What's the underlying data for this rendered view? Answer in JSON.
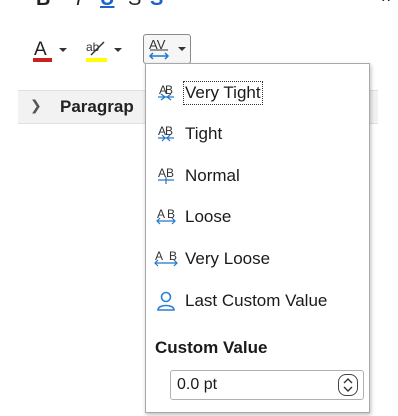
{
  "popup": {
    "items": [
      {
        "label": "Very Tight",
        "icon": "very-tight-spacing-icon"
      },
      {
        "label": "Tight",
        "icon": "tight-spacing-icon"
      },
      {
        "label": "Normal",
        "icon": "normal-spacing-icon"
      },
      {
        "label": "Loose",
        "icon": "loose-spacing-icon"
      },
      {
        "label": "Very Loose",
        "icon": "very-loose-spacing-icon"
      },
      {
        "label": "Last Custom Value",
        "icon": "user-icon"
      }
    ],
    "custom_heading": "Custom Value",
    "custom_value": "0.0 pt"
  },
  "sidebar": {
    "paragraph_label": "Paragrap"
  },
  "toolbar": {
    "font_color_glyph": "A",
    "highlight_glyph": "ab",
    "spacing_glyph": "AV"
  },
  "colors": {
    "font_color_bar": "#c9211e",
    "highlight_bar": "#ffff00",
    "spacing_icon_blue": "#1e78c8",
    "user_icon_blue": "#2a7fd4"
  }
}
